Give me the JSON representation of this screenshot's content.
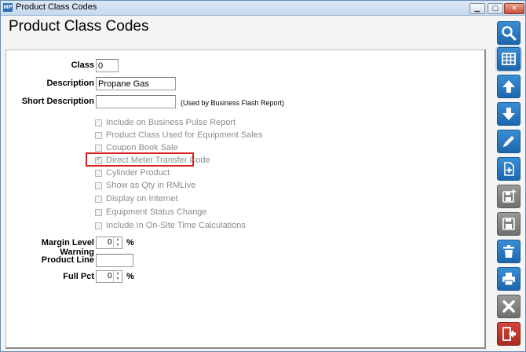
{
  "window": {
    "title": "Product Class Codes",
    "app_icon_text": "MP"
  },
  "page_title": "Product Class Codes",
  "form": {
    "class": {
      "label": "Class",
      "value": "0"
    },
    "description": {
      "label": "Description",
      "value": "Propane Gas"
    },
    "short_description": {
      "label": "Short Description",
      "value": "",
      "note": "(Used by Business Flash Report)"
    },
    "checkboxes": [
      {
        "label": "Include on Business Pulse Report",
        "checked": false
      },
      {
        "label": "Product Class Used for Equipment Sales",
        "checked": false
      },
      {
        "label": "Coupon Book Sale",
        "checked": false
      },
      {
        "label": "Direct Meter Transfer Code",
        "checked": true
      },
      {
        "label": "Cylinder Product",
        "checked": false
      },
      {
        "label": "Show as Qty in RMLive",
        "checked": false
      },
      {
        "label": "Display on Internet",
        "checked": false
      },
      {
        "label": "Equipment Status Change",
        "checked": false
      },
      {
        "label": "Include In On-Site Time Calculations",
        "checked": false
      }
    ],
    "margin_level_warning": {
      "label": "Margin Level Warning",
      "value": "0",
      "unit": "%"
    },
    "product_line": {
      "label": "Product Line",
      "value": ""
    },
    "full_pct": {
      "label": "Full Pct",
      "value": "0",
      "unit": "%"
    }
  },
  "toolbar": [
    {
      "name": "search",
      "icon": "search-icon"
    },
    {
      "name": "grid",
      "icon": "grid-icon"
    },
    {
      "name": "up",
      "icon": "arrow-up-icon"
    },
    {
      "name": "down",
      "icon": "arrow-down-icon"
    },
    {
      "name": "edit",
      "icon": "pencil-icon"
    },
    {
      "name": "new",
      "icon": "new-document-icon"
    },
    {
      "name": "save-new",
      "icon": "save-new-icon"
    },
    {
      "name": "save",
      "icon": "floppy-icon"
    },
    {
      "name": "delete",
      "icon": "trash-icon"
    },
    {
      "name": "print",
      "icon": "printer-icon"
    },
    {
      "name": "cancel",
      "icon": "x-icon"
    },
    {
      "name": "exit",
      "icon": "exit-door-icon"
    }
  ],
  "colors": {
    "toolbar_blue": "#1d66ad",
    "toolbar_gray": "#6f6f6f",
    "exit_red": "#a92a22",
    "highlight_red": "#d92020"
  }
}
